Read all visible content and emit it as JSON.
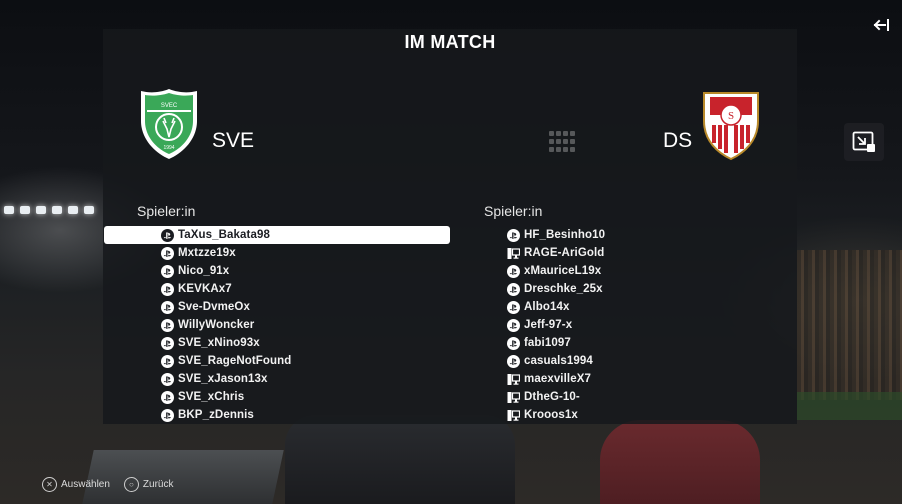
{
  "title": "IM MATCH",
  "home_team": {
    "abbr": "SVE",
    "crest": "green-shield-crest-icon",
    "players_header": "Spieler:in",
    "players": [
      {
        "name": "TaXus_Bakata98",
        "platform": "playstation-icon",
        "selected": true
      },
      {
        "name": "Mxtzze19x",
        "platform": "playstation-icon"
      },
      {
        "name": "Nico_91x",
        "platform": "playstation-icon"
      },
      {
        "name": "KEVKAx7",
        "platform": "playstation-icon"
      },
      {
        "name": "Sve-DvmeOx",
        "platform": "playstation-icon"
      },
      {
        "name": "WillyWoncker",
        "platform": "playstation-icon"
      },
      {
        "name": "SVE_xNino93x",
        "platform": "playstation-icon"
      },
      {
        "name": "SVE_RageNotFound",
        "platform": "playstation-icon"
      },
      {
        "name": "SVE_xJason13x",
        "platform": "playstation-icon"
      },
      {
        "name": "SVE_xChris",
        "platform": "playstation-icon"
      },
      {
        "name": "BKP_zDennis",
        "platform": "playstation-icon"
      }
    ]
  },
  "away_team": {
    "abbr": "DS",
    "crest": "sevilla-crest-icon",
    "players_header": "Spieler:in",
    "players": [
      {
        "name": "HF_Besinho10",
        "platform": "playstation-icon"
      },
      {
        "name": "RAGE-AriGold",
        "platform": "pc-icon"
      },
      {
        "name": "xMauriceL19x",
        "platform": "playstation-icon"
      },
      {
        "name": "Dreschke_25x",
        "platform": "playstation-icon"
      },
      {
        "name": "Albo14x",
        "platform": "playstation-icon"
      },
      {
        "name": "Jeff-97-x",
        "platform": "playstation-icon"
      },
      {
        "name": "fabi1097",
        "platform": "playstation-icon"
      },
      {
        "name": "casuals1994",
        "platform": "playstation-icon"
      },
      {
        "name": "maexvilleX7",
        "platform": "pc-icon"
      },
      {
        "name": "DtheG-10-",
        "platform": "pc-icon"
      },
      {
        "name": "Krooos1x",
        "platform": "pc-icon"
      }
    ]
  },
  "footer": {
    "select_label": "Auswählen",
    "back_label": "Zurück",
    "select_icon": "cross-button-icon",
    "back_icon": "circle-button-icon"
  },
  "colors": {
    "home_green": "#3aa858",
    "away_red": "#c8232c",
    "selected_row_bg": "#ffffff",
    "panel_bg": "#16181c"
  }
}
